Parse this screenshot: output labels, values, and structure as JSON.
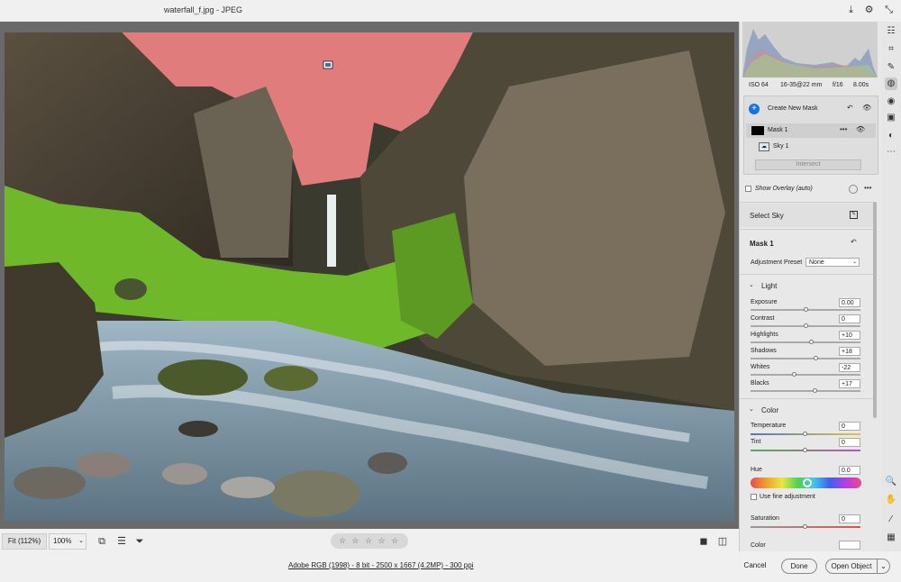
{
  "window": {
    "title": "waterfall_f.jpg  -  JPEG"
  },
  "toolbar_right": {
    "icons": [
      "save-icon",
      "gear-icon",
      "collapse-icon"
    ]
  },
  "bottom": {
    "zoom_fit": "Fit (112%)",
    "zoom_pct": "100%",
    "rating_stars": "☆ ☆ ☆ ☆ ☆ 🗑"
  },
  "status": {
    "file_info": "Adobe RGB (1998) - 8 bit - 2500 x 1667 (4.2MP) - 300 ppi",
    "cancel": "Cancel",
    "done": "Done",
    "open_object": "Open Object"
  },
  "exif": {
    "iso": "ISO 64",
    "lens": "16-35@22 mm",
    "aperture": "f/16",
    "shutter": "8.00s"
  },
  "masks": {
    "create": "Create New Mask",
    "mask1": "Mask 1",
    "sky1": "Sky 1",
    "intersect": "Intersect",
    "show_overlay": "Show Overlay (auto)",
    "select_sky": "Select Sky"
  },
  "mask_settings": {
    "title": "Mask 1",
    "preset_label": "Adjustment Preset",
    "preset_value": "None"
  },
  "light": {
    "heading": "Light",
    "rows": [
      {
        "label": "Exposure",
        "value": "0.00",
        "pos": 0.5
      },
      {
        "label": "Contrast",
        "value": "0",
        "pos": 0.5
      },
      {
        "label": "Highlights",
        "value": "+10",
        "pos": 0.55
      },
      {
        "label": "Shadows",
        "value": "+18",
        "pos": 0.59
      },
      {
        "label": "Whites",
        "value": "-22",
        "pos": 0.39
      },
      {
        "label": "Blacks",
        "value": "+17",
        "pos": 0.585
      }
    ]
  },
  "color": {
    "heading": "Color",
    "temperature_label": "Temperature",
    "temperature_value": "0",
    "tint_label": "Tint",
    "tint_value": "0",
    "hue_label": "Hue",
    "hue_value": "0.0",
    "fine_adjust": "Use fine adjustment",
    "saturation_label": "Saturation",
    "saturation_value": "0",
    "color_label": "Color"
  },
  "accent": "#1473e6"
}
